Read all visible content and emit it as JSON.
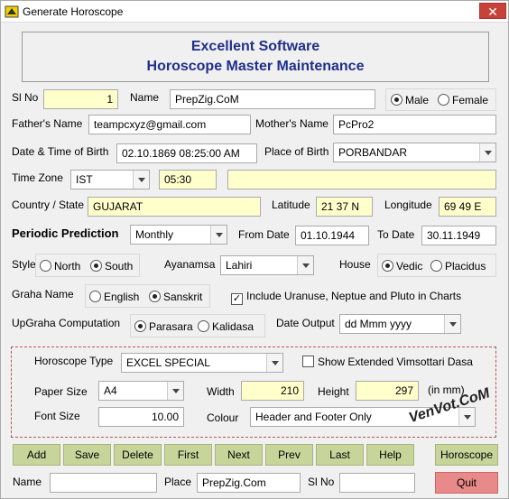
{
  "window": {
    "title": "Generate Horoscope",
    "close_glyph": "✕"
  },
  "header": {
    "line1": "Excellent Software",
    "line2": "Horoscope Master Maintenance"
  },
  "labels": {
    "sl_no": "Sl No",
    "name": "Name",
    "fathers_name": "Father's Name",
    "mothers_name": "Mother's Name",
    "date_time_birth": "Date & Time of Birth",
    "place_of_birth": "Place of Birth",
    "time_zone": "Time Zone",
    "country_state": "Country / State",
    "latitude": "Latitude",
    "longitude": "Longitude",
    "periodic_prediction": "Periodic Prediction",
    "from_date": "From Date",
    "to_date": "To Date",
    "style": "Style",
    "ayanamsa": "Ayanamsa",
    "house": "House",
    "graha_name": "Graha Name",
    "upgraha_computation": "UpGraha Computation",
    "date_output": "Date Output",
    "horoscope_type": "Horoscope Type",
    "paper_size": "Paper Size",
    "width": "Width",
    "height": "Height",
    "in_mm": "(in mm)",
    "font_size": "Font Size",
    "colour": "Colour",
    "bottom_name": "Name",
    "bottom_place": "Place",
    "bottom_sl_no": "Sl No"
  },
  "fields": {
    "sl_no": "1",
    "name": "PrepZig.CoM",
    "fathers_name": "teampcxyz@gmail.com",
    "mothers_name": "PcPro2",
    "date_time_birth": "02.10.1869 08:25:00 AM",
    "place_of_birth": "PORBANDAR",
    "time_zone": "IST",
    "time_offset": "05:30",
    "time_extra": "",
    "country_state": "GUJARAT",
    "latitude": "21 37 N",
    "longitude": "69 49 E",
    "periodic_prediction": "Monthly",
    "from_date": "01.10.1944",
    "to_date": "30.11.1949",
    "ayanamsa": "Lahiri",
    "date_output": "dd Mmm yyyy",
    "horoscope_type": "EXCEL SPECIAL",
    "paper_size": "A4",
    "width": "210",
    "height": "297",
    "font_size": "10.00",
    "colour": "Header and Footer Only",
    "bottom_name": "",
    "bottom_place": "PrepZig.Com",
    "bottom_sl_no": ""
  },
  "options": {
    "gender": {
      "male": "Male",
      "female": "Female",
      "selected": "male"
    },
    "style": {
      "north": "North",
      "south": "South",
      "selected": "south"
    },
    "house": {
      "vedic": "Vedic",
      "placidus": "Placidus",
      "selected": "vedic"
    },
    "graha": {
      "english": "English",
      "sanskrit": "Sanskrit",
      "selected": "sanskrit"
    },
    "upgraha": {
      "parasara": "Parasara",
      "kalidasa": "Kalidasa",
      "selected": "parasara"
    },
    "include_outer_planets": {
      "label": "Include Uranuse, Neptue and Pluto in Charts",
      "checked": true
    },
    "extended_vimsottari": {
      "label": "Show Extended Vimsottari Dasa",
      "checked": false
    }
  },
  "buttons": {
    "add": "Add",
    "save": "Save",
    "delete": "Delete",
    "first": "First",
    "next": "Next",
    "prev": "Prev",
    "last": "Last",
    "help": "Help",
    "horoscope": "Horoscope",
    "quit": "Quit"
  },
  "watermark": "VenVot.CoM",
  "colors": {
    "header_text": "#1f2f8a",
    "button_bg": "#c7d49a",
    "quit_bg": "#e88a8a",
    "highlight_field": "#ffffcc"
  }
}
